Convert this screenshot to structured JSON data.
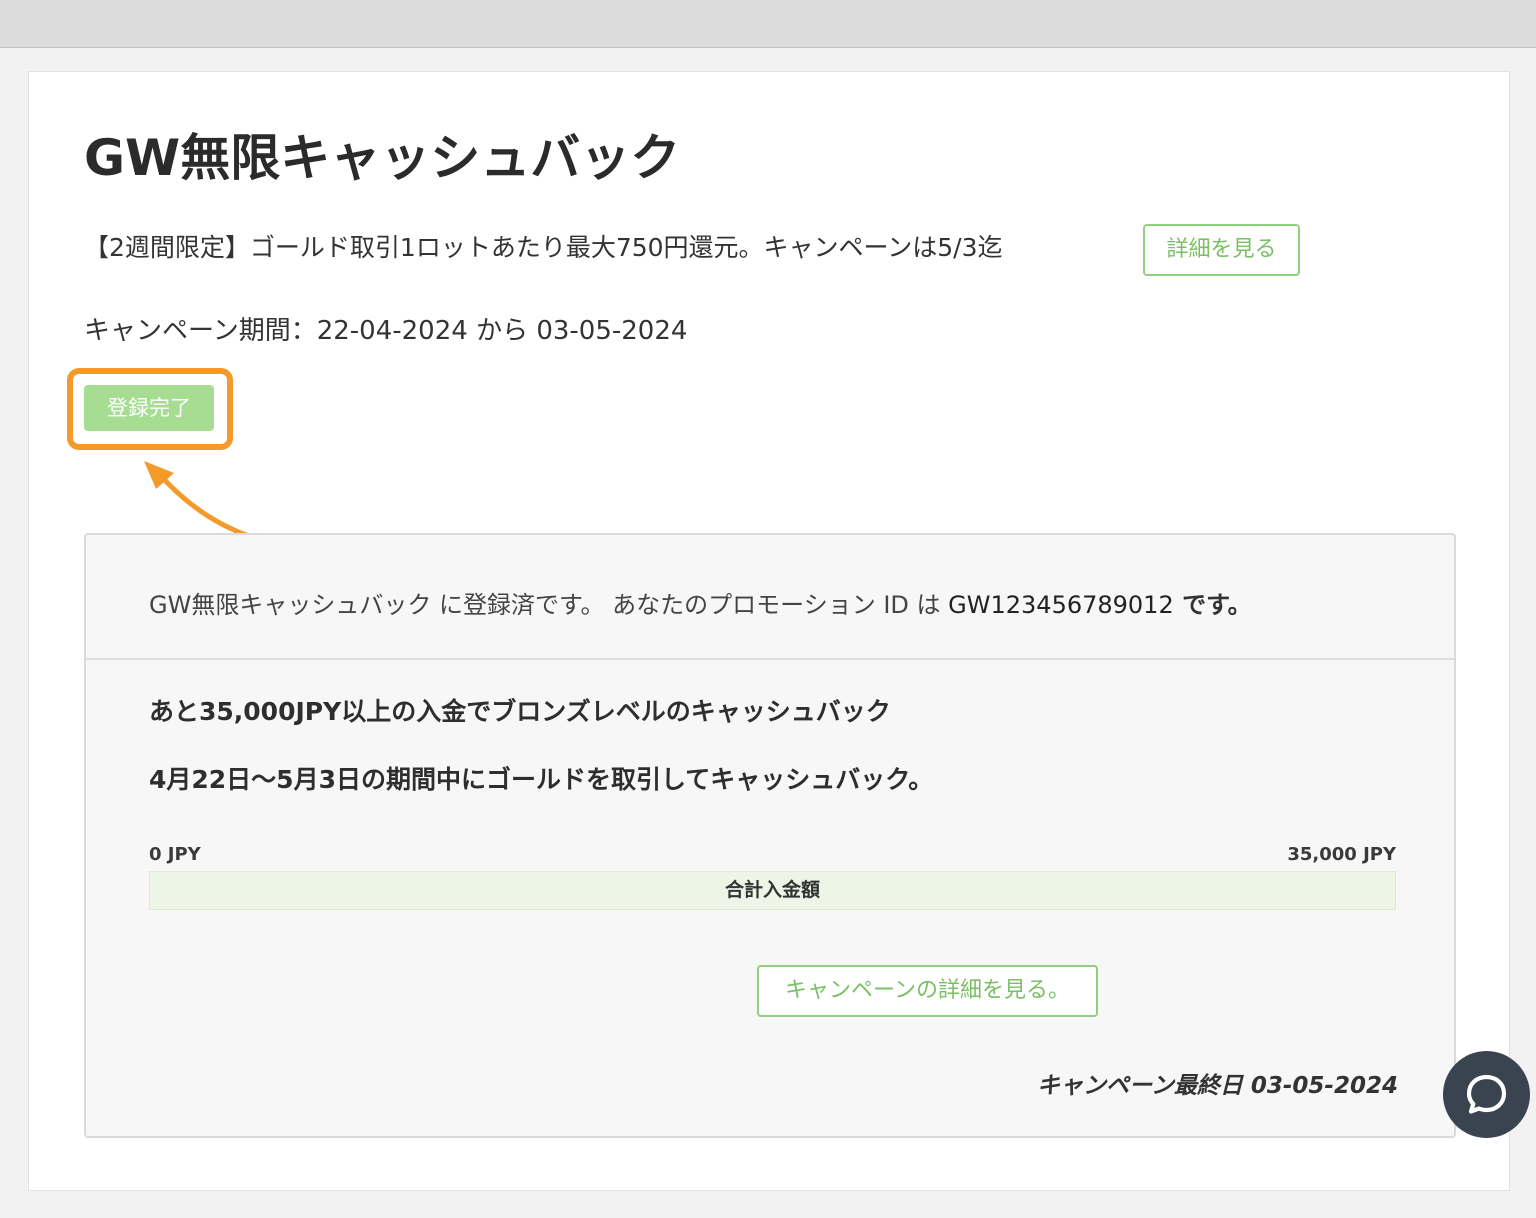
{
  "page": {
    "title": "GW無限キャッシュバック",
    "summary": "【2週間限定】ゴールド取引1ロットあたり最大750円還元。キャンペーンは5/3迄",
    "details_button": "詳細を見る",
    "period": "キャンペーン期間：22-04-2024 から 03-05-2024",
    "registered_button": "登録完了"
  },
  "panel": {
    "registered_message_prefix": "GW無限キャッシュバック に登録済です。 あなたのプロモーション ID は ",
    "promotion_id": "GW123456789012",
    "registered_message_suffix": " です。",
    "line1": "あと35,000JPY以上の入金でブロンズレベルのキャッシュバック",
    "line2": "4月22日〜5月3日の期間中にゴールドを取引してキャッシュバック。",
    "progress": {
      "min_label": "0 JPY",
      "max_label": "35,000 JPY",
      "bar_label": "合計入金額",
      "value": 0
    },
    "campaign_details_button": "キャンペーンの詳細を見る。",
    "end_date": "キャンペーン最終日 03-05-2024"
  },
  "chat": {
    "icon": "chat-bubble-icon"
  },
  "colors": {
    "accent_green": "#79c064",
    "button_green_fill": "#a6dd93",
    "highlight_orange": "#f39a2b",
    "chat_button": "#3a4350"
  }
}
